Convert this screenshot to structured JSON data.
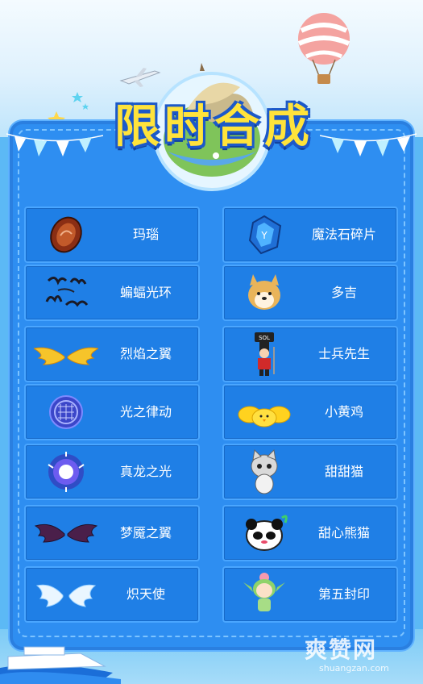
{
  "title": "限时合成",
  "left_items": [
    {
      "label": "玛瑙",
      "icon": "agate-gem-icon"
    },
    {
      "label": "蝙蝠光环",
      "icon": "bat-halo-icon"
    },
    {
      "label": "烈焰之翼",
      "icon": "flame-wings-icon"
    },
    {
      "label": "光之律动",
      "icon": "light-rhythm-icon"
    },
    {
      "label": "真龙之光",
      "icon": "dragon-light-icon"
    },
    {
      "label": "梦魇之翼",
      "icon": "nightmare-wings-icon"
    },
    {
      "label": "炽天使",
      "icon": "seraph-wings-icon"
    }
  ],
  "right_items": [
    {
      "label": "魔法石碎片",
      "icon": "magic-stone-fragment-icon"
    },
    {
      "label": "多吉",
      "icon": "doge-pet-icon"
    },
    {
      "label": "士兵先生",
      "icon": "soldier-pet-icon"
    },
    {
      "label": "小黄鸡",
      "icon": "yellow-chicks-icon"
    },
    {
      "label": "甜甜猫",
      "icon": "sweet-cat-icon"
    },
    {
      "label": "甜心熊猫",
      "icon": "sweet-panda-icon"
    },
    {
      "label": "第五封印",
      "icon": "fifth-seal-icon"
    }
  ],
  "soldier_sign": "SOL",
  "watermark": {
    "main": "爽赞网",
    "sub": "shuangzan.com"
  },
  "colors": {
    "panel": "#2e8ef1",
    "item": "#1f7fe6",
    "title": "#ffe33b",
    "title_outline": "#1c59c9"
  }
}
